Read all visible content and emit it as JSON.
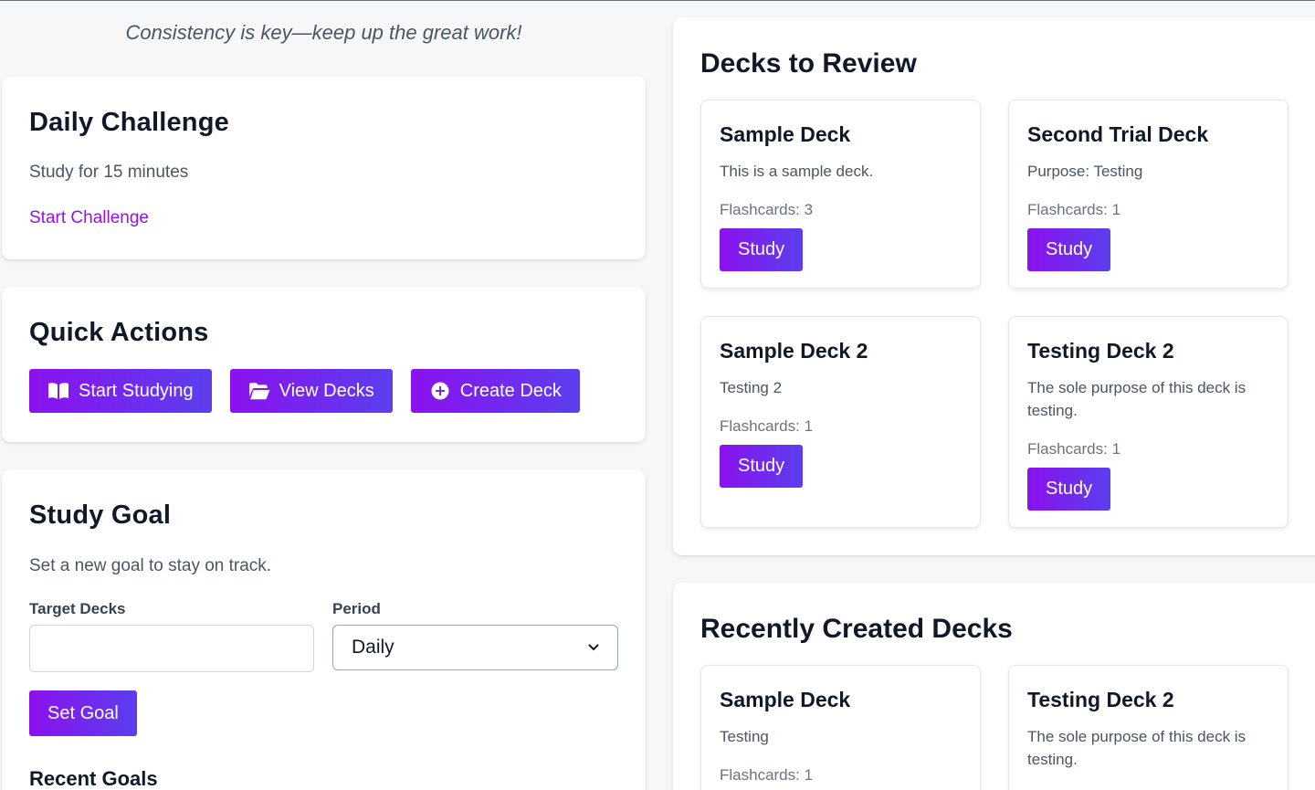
{
  "motto": "Consistency is key—keep up the great work!",
  "daily_challenge": {
    "title": "Daily Challenge",
    "text": "Study for 15 minutes",
    "link": "Start Challenge"
  },
  "quick_actions": {
    "title": "Quick Actions",
    "buttons": [
      {
        "label": "Start Studying",
        "icon": "book-open-icon"
      },
      {
        "label": "View Decks",
        "icon": "folder-open-icon"
      },
      {
        "label": "Create Deck",
        "icon": "plus-circle-icon"
      }
    ]
  },
  "study_goal": {
    "title": "Study Goal",
    "subtitle": "Set a new goal to stay on track.",
    "target_label": "Target Decks",
    "target_value": "",
    "period_label": "Period",
    "period_value": "Daily",
    "submit": "Set Goal",
    "recent_title": "Recent Goals"
  },
  "decks_to_review": {
    "title": "Decks to Review",
    "decks": [
      {
        "name": "Sample Deck",
        "description": "This is a sample deck.",
        "count": "Flashcards: 3",
        "button": "Study"
      },
      {
        "name": "Second Trial Deck",
        "description": "Purpose: Testing",
        "count": "Flashcards: 1",
        "button": "Study"
      },
      {
        "name": "Sample Deck 2",
        "description": "Testing 2",
        "count": "Flashcards: 1",
        "button": "Study"
      },
      {
        "name": "Testing Deck 2",
        "description": "The sole purpose of this deck is testing.",
        "count": "Flashcards: 1",
        "button": "Study"
      }
    ]
  },
  "recently_created": {
    "title": "Recently Created Decks",
    "decks": [
      {
        "name": "Sample Deck",
        "description": "Testing",
        "count": "Flashcards: 1"
      },
      {
        "name": "Testing Deck 2",
        "description": "The sole purpose of this deck is testing."
      }
    ]
  },
  "colors": {
    "accent_start": "#8b11ee",
    "accent_end": "#5b3fee",
    "link": "#9313e6"
  }
}
